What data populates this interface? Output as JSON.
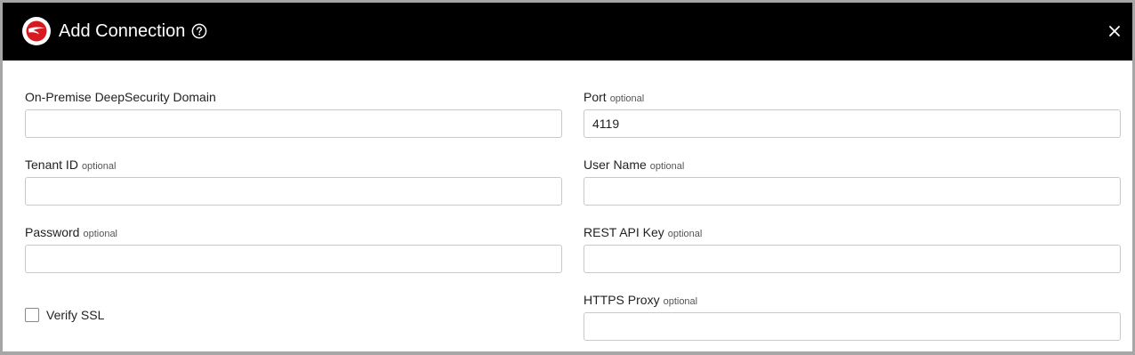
{
  "dialog": {
    "title": "Add Connection",
    "logo_icon": "trend-micro-logo",
    "help_icon": "question-circle-icon",
    "close_icon": "close-icon"
  },
  "fields": {
    "domain": {
      "label": "On-Premise DeepSecurity Domain",
      "optional": "",
      "value": "",
      "placeholder": ""
    },
    "port": {
      "label": "Port",
      "optional": "optional",
      "value": "4119",
      "placeholder": ""
    },
    "tenant_id": {
      "label": "Tenant ID",
      "optional": "optional",
      "value": "",
      "placeholder": ""
    },
    "user_name": {
      "label": "User Name",
      "optional": "optional",
      "value": "",
      "placeholder": ""
    },
    "password": {
      "label": "Password",
      "optional": "optional",
      "value": "",
      "placeholder": ""
    },
    "rest_api_key": {
      "label": "REST API Key",
      "optional": "optional",
      "value": "",
      "placeholder": ""
    },
    "https_proxy": {
      "label": "HTTPS Proxy",
      "optional": "optional",
      "value": "",
      "placeholder": ""
    }
  },
  "verify_ssl": {
    "label": "Verify SSL",
    "checked": false
  },
  "colors": {
    "header_bg": "#000000",
    "logo_red": "#d71920",
    "frame": "#a6a6a6",
    "input_border": "#c9c9c9"
  }
}
